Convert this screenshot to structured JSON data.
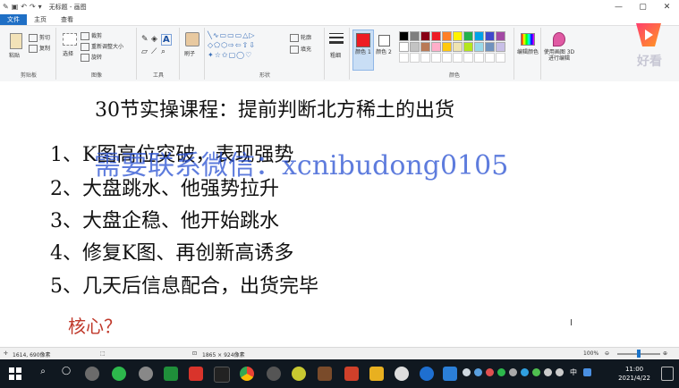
{
  "window": {
    "title": "无标题 - 画图",
    "min": "—",
    "max": "▢",
    "close": "✕"
  },
  "ribbon_tabs": [
    "文件",
    "主页",
    "查看"
  ],
  "ribbon": {
    "clipboard": {
      "label": "剪贴板",
      "paste": "粘贴",
      "cut": "剪切",
      "copy": "复制"
    },
    "image": {
      "label": "图像",
      "select": "选择",
      "crop": "裁剪",
      "resize": "重新调整大小",
      "rotate": "旋转"
    },
    "tools": {
      "label": "工具"
    },
    "brushes": "刷子",
    "shapes": {
      "label": "形状",
      "outline": "轮廓",
      "fill": "填充"
    },
    "size": "粗细",
    "color1": "颜色 1",
    "color2": "颜色 2",
    "colors_label": "颜色",
    "edit_colors": "编辑颜色",
    "paint3d": "使用画图 3D 进行编辑",
    "palette": [
      "#000000",
      "#7f7f7f",
      "#880015",
      "#ed1c24",
      "#ff7f27",
      "#fff200",
      "#22b14c",
      "#00a2e8",
      "#3f48cc",
      "#a349a4",
      "#ffffff",
      "#c3c3c3",
      "#b97a57",
      "#ffaec9",
      "#ffc90e",
      "#efe4b0",
      "#b5e61d",
      "#99d9ea",
      "#7092be",
      "#c8bfe7"
    ],
    "color1_value": "#ed1c24"
  },
  "canvas": {
    "title": "30节实操课程：提前判断北方稀土的出货",
    "lines": [
      "1、K图高位突破，表现强势",
      "2、大盘跳水、他强势拉升",
      "3、大盘企稳、他开始跳水",
      "4、修复K图、再创新高诱多",
      "5、几天后信息配合，出货完毕"
    ],
    "core": "核心？",
    "watermark": "需要联系微信：xcnibudong0105"
  },
  "brand": {
    "name": "好看"
  },
  "statusbar": {
    "cursor_pos": "1614, 690像素",
    "canvas_size": "1865 × 924像素",
    "zoom": "100%"
  },
  "taskbar": {
    "time": "11:00",
    "date": "2021/4/22",
    "lang": "中"
  }
}
